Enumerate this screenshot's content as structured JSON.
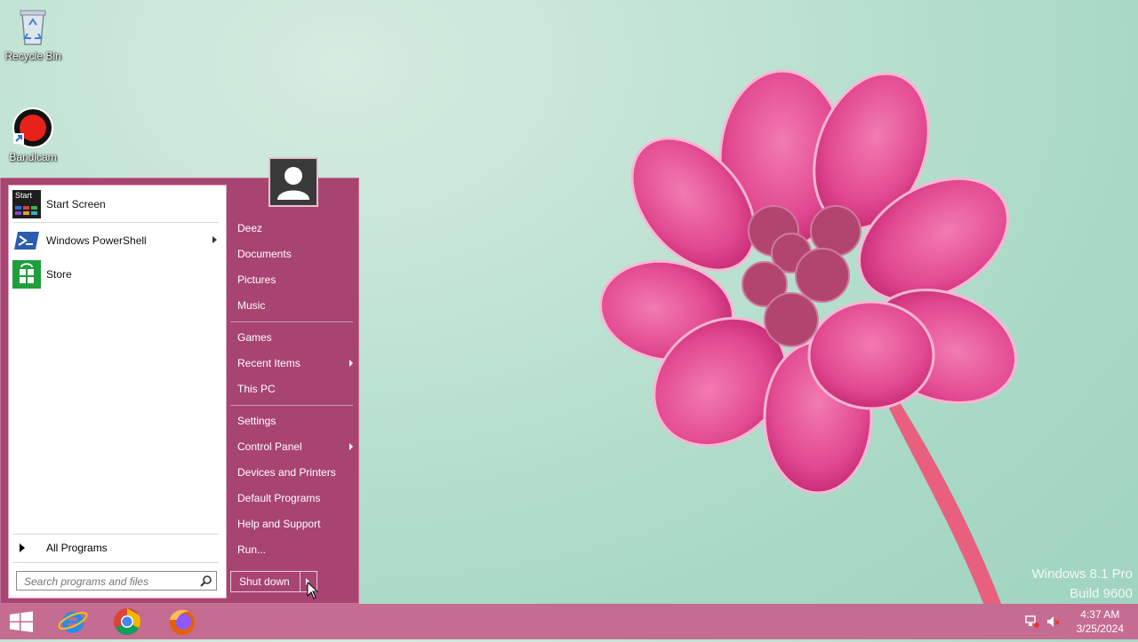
{
  "desktop": {
    "icons": [
      {
        "label": "Recycle Bin",
        "icon": "recycle-bin-icon"
      },
      {
        "label": "Bandicam",
        "icon": "bandicam-icon"
      }
    ],
    "watermark": {
      "line1": "Windows 8.1 Pro",
      "line2": "Build 9600"
    }
  },
  "start_menu": {
    "pinned": [
      {
        "label": "Start Screen",
        "icon": "start-screen-icon",
        "icon_text": "Start"
      },
      {
        "label": "Windows PowerShell",
        "icon": "powershell-icon",
        "has_submenu": true
      },
      {
        "label": "Store",
        "icon": "store-icon"
      }
    ],
    "all_programs": "All Programs",
    "search": {
      "placeholder": "Search programs and files",
      "value": ""
    },
    "user": {
      "icon": "user-avatar-icon"
    },
    "right_items": [
      {
        "label": "Deez"
      },
      {
        "label": "Documents"
      },
      {
        "label": "Pictures"
      },
      {
        "label": "Music"
      },
      {
        "label": "Games"
      },
      {
        "label": "Recent Items",
        "has_submenu": true
      },
      {
        "label": "This PC"
      },
      {
        "label": "Settings"
      },
      {
        "label": "Control Panel",
        "has_submenu": true
      },
      {
        "label": "Devices and Printers"
      },
      {
        "label": "Default Programs"
      },
      {
        "label": "Help and Support"
      },
      {
        "label": "Run..."
      }
    ],
    "shutdown_label": "Shut down"
  },
  "taskbar": {
    "apps": [
      {
        "icon": "windows-start-icon"
      },
      {
        "icon": "internet-explorer-icon"
      },
      {
        "icon": "chrome-icon"
      },
      {
        "icon": "firefox-icon"
      }
    ],
    "tray": {
      "network_icon": "network-icon",
      "volume_icon": "volume-muted-icon"
    },
    "clock": {
      "time": "4:37 AM",
      "date": "3/25/2024"
    }
  },
  "colors": {
    "start_menu_bg": "#a84472",
    "taskbar_bg": "#c46c92",
    "desktop_bg": "#bfe3d3"
  }
}
